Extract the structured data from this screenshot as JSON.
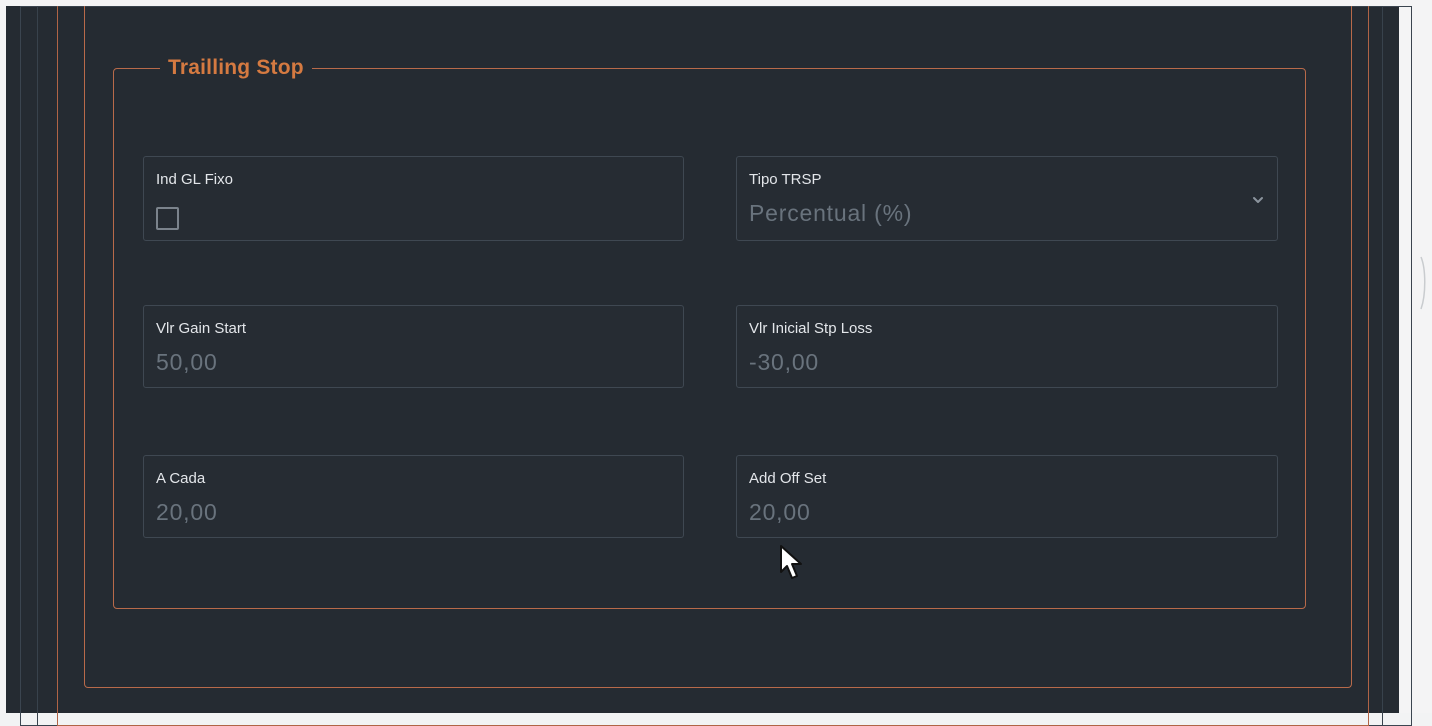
{
  "fieldset": {
    "legend": "Trailling Stop"
  },
  "fields": {
    "ind_gl_fixo": {
      "label": "Ind GL Fixo",
      "checked": false
    },
    "tipo_trsp": {
      "label": "Tipo TRSP",
      "value": "Percentual (%)"
    },
    "vlr_gain_start": {
      "label": "Vlr Gain Start",
      "value": "50,00"
    },
    "vlr_inicial_stp_loss": {
      "label": "Vlr Inicial Stp Loss",
      "value": "-30,00"
    },
    "a_cada": {
      "label": "A Cada",
      "value": "20,00"
    },
    "add_off_set": {
      "label": "Add Off Set",
      "value": "20,00"
    }
  },
  "icons": {
    "select_arrow": "chevron-down-icon",
    "pointer": "mouse-cursor-icon"
  },
  "colors": {
    "background": "#252b32",
    "accent": "#d57a41",
    "border_accent": "#b86a4a",
    "label": "#e3e6ea",
    "value": "#69737d"
  }
}
